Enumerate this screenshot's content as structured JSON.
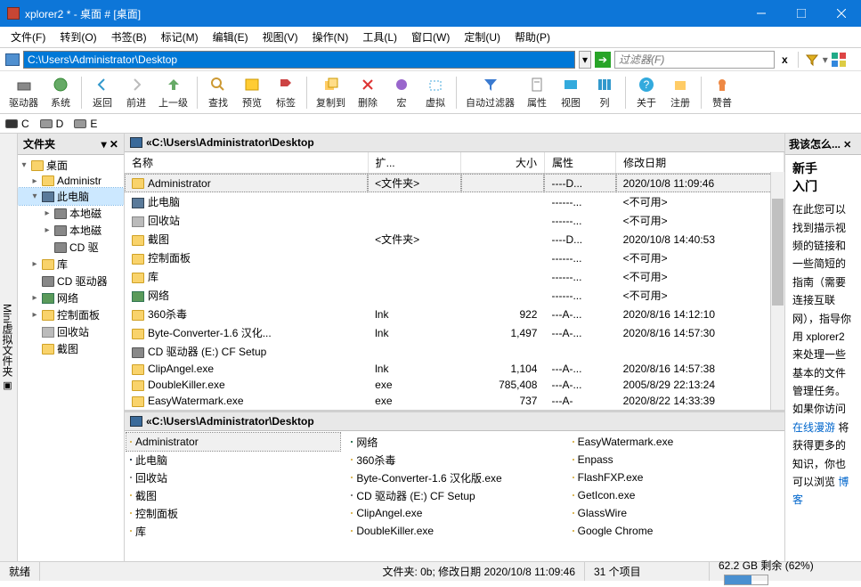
{
  "window": {
    "title": "xplorer2 * - 桌面 # [桌面]"
  },
  "menu": [
    "文件(F)",
    "转到(O)",
    "书签(B)",
    "标记(M)",
    "编辑(E)",
    "视图(V)",
    "操作(N)",
    "工具(L)",
    "窗口(W)",
    "定制(U)",
    "帮助(P)"
  ],
  "address": {
    "path": "C:\\Users\\Administrator\\Desktop",
    "filter_placeholder": "过滤器(F)"
  },
  "toolbar": [
    {
      "label": "驱动器"
    },
    {
      "label": "系统"
    },
    {
      "sep": true
    },
    {
      "label": "返回"
    },
    {
      "label": "前进"
    },
    {
      "label": "上一级"
    },
    {
      "sep": true
    },
    {
      "label": "查找"
    },
    {
      "label": "预览"
    },
    {
      "label": "标签"
    },
    {
      "sep": true
    },
    {
      "label": "复制到"
    },
    {
      "label": "删除"
    },
    {
      "label": "宏"
    },
    {
      "label": "虚拟"
    },
    {
      "sep": true
    },
    {
      "label": "自动过滤器"
    },
    {
      "label": "属性"
    },
    {
      "label": "视图"
    },
    {
      "label": "列"
    },
    {
      "sep": true
    },
    {
      "label": "关于"
    },
    {
      "label": "注册"
    },
    {
      "sep": true
    },
    {
      "label": "赞普"
    }
  ],
  "drives": [
    {
      "label": "C"
    },
    {
      "label": "D"
    },
    {
      "label": "E"
    }
  ],
  "tree": {
    "header": "文件夹",
    "vtab": "Mini虚拟文件夹",
    "nodes": [
      {
        "label": "桌面",
        "icon": "folder",
        "indent": 0,
        "exp": "-"
      },
      {
        "label": "Administr",
        "icon": "user",
        "indent": 1,
        "exp": "+"
      },
      {
        "label": "此电脑",
        "icon": "pc",
        "indent": 1,
        "exp": "-",
        "sel": true
      },
      {
        "label": "本地磁",
        "icon": "drive",
        "indent": 2,
        "exp": "+"
      },
      {
        "label": "本地磁",
        "icon": "drive",
        "indent": 2,
        "exp": "+"
      },
      {
        "label": "CD 驱",
        "icon": "cd",
        "indent": 2,
        "exp": ""
      },
      {
        "label": "库",
        "icon": "lib",
        "indent": 1,
        "exp": "+"
      },
      {
        "label": "CD 驱动器",
        "icon": "cd",
        "indent": 1,
        "exp": ""
      },
      {
        "label": "网络",
        "icon": "net",
        "indent": 1,
        "exp": "+"
      },
      {
        "label": "控制面板",
        "icon": "cp",
        "indent": 1,
        "exp": "+"
      },
      {
        "label": "回收站",
        "icon": "bin",
        "indent": 1,
        "exp": ""
      },
      {
        "label": "截图",
        "icon": "folder",
        "indent": 1,
        "exp": ""
      }
    ]
  },
  "list": {
    "breadcrumb": "«C:\\Users\\Administrator\\Desktop",
    "columns": [
      "名称",
      "扩...",
      "大小",
      "属性",
      "修改日期"
    ],
    "rows": [
      {
        "name": "Administrator",
        "ext": "<文件夹>",
        "size": "",
        "attr": "----D...",
        "date": "2020/10/8 11:09:46",
        "icon": "user",
        "sel": true
      },
      {
        "name": "此电脑",
        "ext": "",
        "size": "",
        "attr": "------...",
        "date": "<不可用>",
        "icon": "pc"
      },
      {
        "name": "回收站",
        "ext": "",
        "size": "",
        "attr": "------...",
        "date": "<不可用>",
        "icon": "bin"
      },
      {
        "name": "截图",
        "ext": "<文件夹>",
        "size": "",
        "attr": "----D...",
        "date": "2020/10/8 14:40:53",
        "icon": "folder"
      },
      {
        "name": "控制面板",
        "ext": "",
        "size": "",
        "attr": "------...",
        "date": "<不可用>",
        "icon": "cp"
      },
      {
        "name": "库",
        "ext": "",
        "size": "",
        "attr": "------...",
        "date": "<不可用>",
        "icon": "lib"
      },
      {
        "name": "网络",
        "ext": "",
        "size": "",
        "attr": "------...",
        "date": "<不可用>",
        "icon": "net"
      },
      {
        "name": "360杀毒",
        "ext": "lnk",
        "size": "922",
        "attr": "---A-...",
        "date": "2020/8/16 14:12:10",
        "icon": "app"
      },
      {
        "name": "Byte-Converter-1.6 汉化...",
        "ext": "lnk",
        "size": "1,497",
        "attr": "---A-...",
        "date": "2020/8/16 14:57:30",
        "icon": "app"
      },
      {
        "name": "CD 驱动器 (E:) CF Setup",
        "ext": "",
        "size": "",
        "attr": "",
        "date": "",
        "icon": "cd"
      },
      {
        "name": "ClipAngel.exe",
        "ext": "lnk",
        "size": "1,104",
        "attr": "---A-...",
        "date": "2020/8/16 14:57:38",
        "icon": "app"
      },
      {
        "name": "DoubleKiller.exe",
        "ext": "exe",
        "size": "785,408",
        "attr": "---A-...",
        "date": "2005/8/29 22:13:24",
        "icon": "exe"
      },
      {
        "name": "EasyWatermark.exe",
        "ext": "exe",
        "size": "737",
        "attr": "---A-",
        "date": "2020/8/22 14:33:39",
        "icon": "exe"
      }
    ]
  },
  "grid": {
    "breadcrumb": "«C:\\Users\\Administrator\\Desktop",
    "items": [
      {
        "label": "Administrator",
        "icon": "user",
        "sel": true
      },
      {
        "label": "网络",
        "icon": "net"
      },
      {
        "label": "EasyWatermark.exe",
        "icon": "exe"
      },
      {
        "label": "此电脑",
        "icon": "pc"
      },
      {
        "label": "360杀毒",
        "icon": "app"
      },
      {
        "label": "Enpass",
        "icon": "app"
      },
      {
        "label": "回收站",
        "icon": "bin"
      },
      {
        "label": "Byte-Converter-1.6 汉化版.exe",
        "icon": "app"
      },
      {
        "label": "FlashFXP.exe",
        "icon": "app"
      },
      {
        "label": "截图",
        "icon": "folder"
      },
      {
        "label": "CD 驱动器 (E:) CF Setup",
        "icon": "cd"
      },
      {
        "label": "GetIcon.exe",
        "icon": "exe"
      },
      {
        "label": "控制面板",
        "icon": "cp"
      },
      {
        "label": "ClipAngel.exe",
        "icon": "app"
      },
      {
        "label": "GlassWire",
        "icon": "app"
      },
      {
        "label": "库",
        "icon": "lib"
      },
      {
        "label": "DoubleKiller.exe",
        "icon": "exe"
      },
      {
        "label": "Google Chrome",
        "icon": "chrome"
      }
    ]
  },
  "side": {
    "header": "我该怎么...",
    "heading": "新手\n入门",
    "body": "在此您可以找到描示视频的链接和一些简短的指南（需要连接互联网），指导你用 xplorer2 来处理一些基本的文件管理任务。如果你访问",
    "link1": "在线漫游",
    "body2": "将获得更多的知识，你也可以浏览",
    "link2": "博客"
  },
  "status": {
    "left": "就绪",
    "mid": "文件夹: 0b; 修改日期 2020/10/8 11:09:46",
    "count": "31 个项目",
    "disk": "62.2 GB 剩余 (62%)"
  }
}
